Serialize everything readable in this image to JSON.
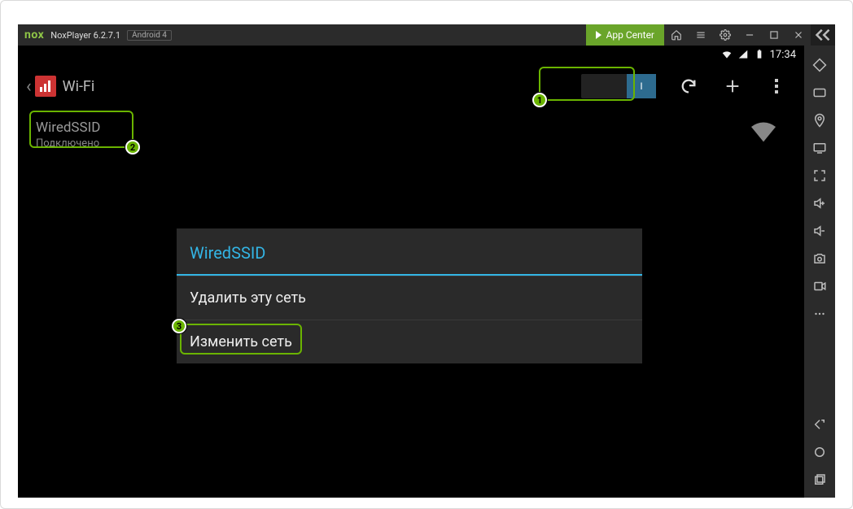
{
  "window": {
    "logo": "nox",
    "title": "NoxPlayer 6.2.7.1",
    "api_badge": "Android 4",
    "app_center": "App Center"
  },
  "status": {
    "time": "17:34"
  },
  "wifi": {
    "title": "Wi-Fi",
    "toggle_on": "I",
    "network": {
      "name": "WiredSSID",
      "status": "Подключено"
    }
  },
  "context": {
    "title": "WiredSSID",
    "forget": "Удалить эту сеть",
    "modify": "Изменить сеть"
  },
  "callouts": {
    "c1": "1",
    "c2": "2",
    "c3": "3"
  }
}
